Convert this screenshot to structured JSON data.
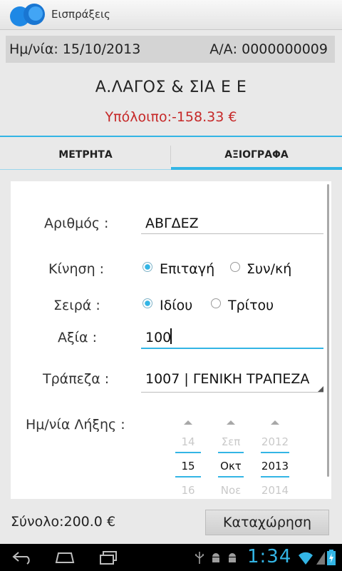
{
  "app": {
    "title": "Εισπράξεις"
  },
  "info": {
    "date": "Ημ/νία: 15/10/2013",
    "doc_number": "Α/Α: 0000000009"
  },
  "customer": {
    "name": "Α.ΛΑΓΟΣ & ΣΙΑ Ε Ε",
    "balance": "Υπόλοιπο:-158.33 €"
  },
  "tabs": [
    {
      "label": "ΜΕΤΡΗΤΑ",
      "selected": false
    },
    {
      "label": "ΑΞΙΟΓΡΑΦΑ",
      "selected": true
    }
  ],
  "form": {
    "number": {
      "label": "Αριθμός :",
      "value": "ΑΒΓΔΕΖ"
    },
    "movement": {
      "label": "Κίνηση :",
      "options": [
        "Επιταγή",
        "Συν/κή"
      ],
      "selected": "Επιταγή"
    },
    "series": {
      "label": "Σειρά :",
      "options": [
        "Ιδίου",
        "Τρίτου"
      ],
      "selected": "Ιδίου"
    },
    "value": {
      "label": "Αξία :",
      "value": "100"
    },
    "bank": {
      "label": "Τράπεζα :",
      "value": "1007 | ΓΕΝΙΚΗ ΤΡΑΠΕΖΑ"
    },
    "expiry": {
      "label": "Ημ/νία Λήξης :",
      "day": {
        "prev": "14",
        "selected": "15",
        "next": "16"
      },
      "month": {
        "prev": "Σεπ",
        "selected": "Οκτ",
        "next": "Νοε"
      },
      "year": {
        "prev": "2012",
        "selected": "2013",
        "next": "2014"
      }
    }
  },
  "footer": {
    "total": "Σύνολο:200.0 €",
    "submit_label": "Καταχώρηση"
  },
  "system": {
    "clock": "1:34"
  },
  "colors": {
    "accent": "#33b5e5",
    "balance": "#c62828"
  }
}
